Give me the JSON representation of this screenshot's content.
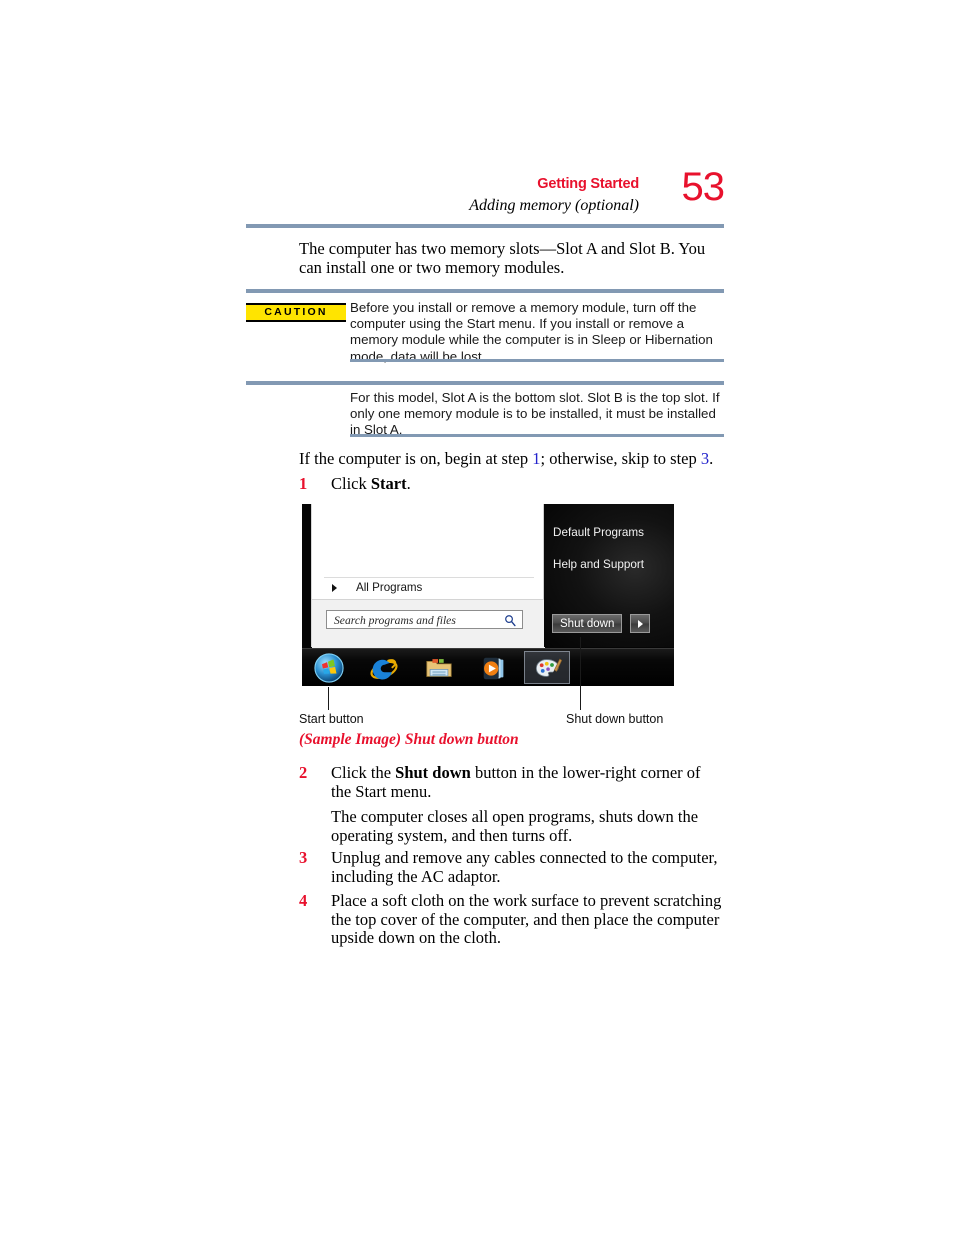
{
  "header": {
    "chapter": "Getting Started",
    "section": "Adding memory (optional)",
    "page_number": "53",
    "accent_color": "#e8112d",
    "rule_color": "#8299b3"
  },
  "intro": {
    "text": "The computer has two memory slots—Slot A and Slot B. You can install one or two memory modules."
  },
  "caution": {
    "label": "CAUTION",
    "label_bg": "#ffe400",
    "text": "Before you install or remove a memory module, turn off the computer using the Start menu. If you install or remove a memory module while the computer is in Sleep or Hibernation mode, data will be lost."
  },
  "note": {
    "text": "For this model, Slot A is the bottom slot. Slot B is the top slot. If only one memory module is to be installed, it must be installed in Slot A."
  },
  "leadin": {
    "part1": "If the computer is on, begin at step ",
    "xref1": "1",
    "part2": "; otherwise, skip to step ",
    "xref2": "3",
    "part3": ".",
    "xref_color": "#2222cc"
  },
  "steps": [
    {
      "num": "1",
      "pre": "Click ",
      "bold": "Start",
      "post": "."
    },
    {
      "num": "2",
      "pre": "Click the ",
      "bold": "Shut down",
      "post": " button in the lower-right corner of the Start menu.",
      "continuation": "The computer closes all open programs, shuts down the operating system, and then turns off."
    },
    {
      "num": "3",
      "pre": "",
      "bold": "",
      "post": "Unplug and remove any cables connected to the computer, including the AC adaptor."
    },
    {
      "num": "4",
      "pre": "",
      "bold": "",
      "post": "Place a soft cloth on the work surface to prevent scratching the top cover of the computer, and then place the computer upside down on the cloth."
    }
  ],
  "figure": {
    "start_menu": {
      "all_programs": "All Programs",
      "search_placeholder": "Search programs and files",
      "right_items": [
        "Default Programs",
        "Help and Support"
      ],
      "shutdown_label": "Shut down",
      "taskbar_icons": [
        "windows-start-orb-icon",
        "internet-explorer-icon",
        "windows-explorer-folder-icon",
        "windows-media-player-icon",
        "paint-icon"
      ]
    },
    "callouts": {
      "start_button": "Start button",
      "shut_down_button": "Shut down button"
    },
    "caption": "(Sample Image) Shut down button"
  }
}
